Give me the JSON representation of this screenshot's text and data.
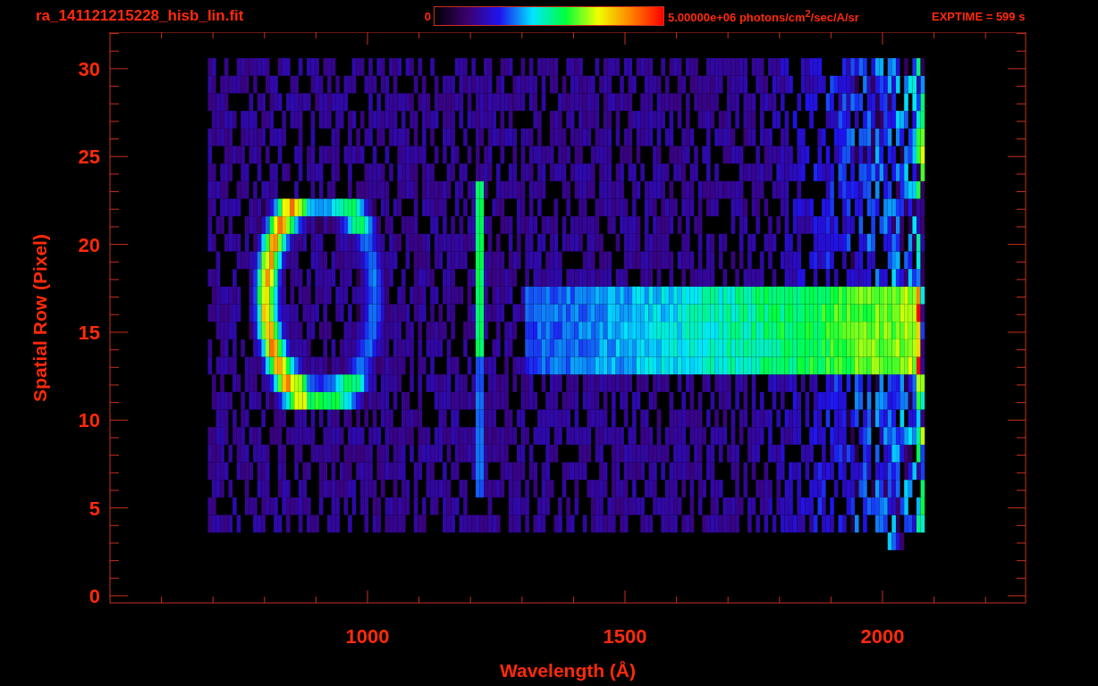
{
  "title": "ra_141121215228_hisb_lin.fit",
  "colorbar": {
    "min_label": "0",
    "max_label": "5.00000e+06 photons/cm$^{2}$/sec/A/sr"
  },
  "exposure": "EXPTIME = 599 s",
  "plot": {
    "x_axis": {
      "title": "Wavelength (Å)",
      "ticks": [
        "1000",
        "1500",
        "2000"
      ]
    },
    "y_axis": {
      "title": "Spatial Row (Pixel)",
      "ticks": [
        "30",
        "25",
        "20",
        "15",
        "10",
        "5",
        "0"
      ]
    }
  }
}
